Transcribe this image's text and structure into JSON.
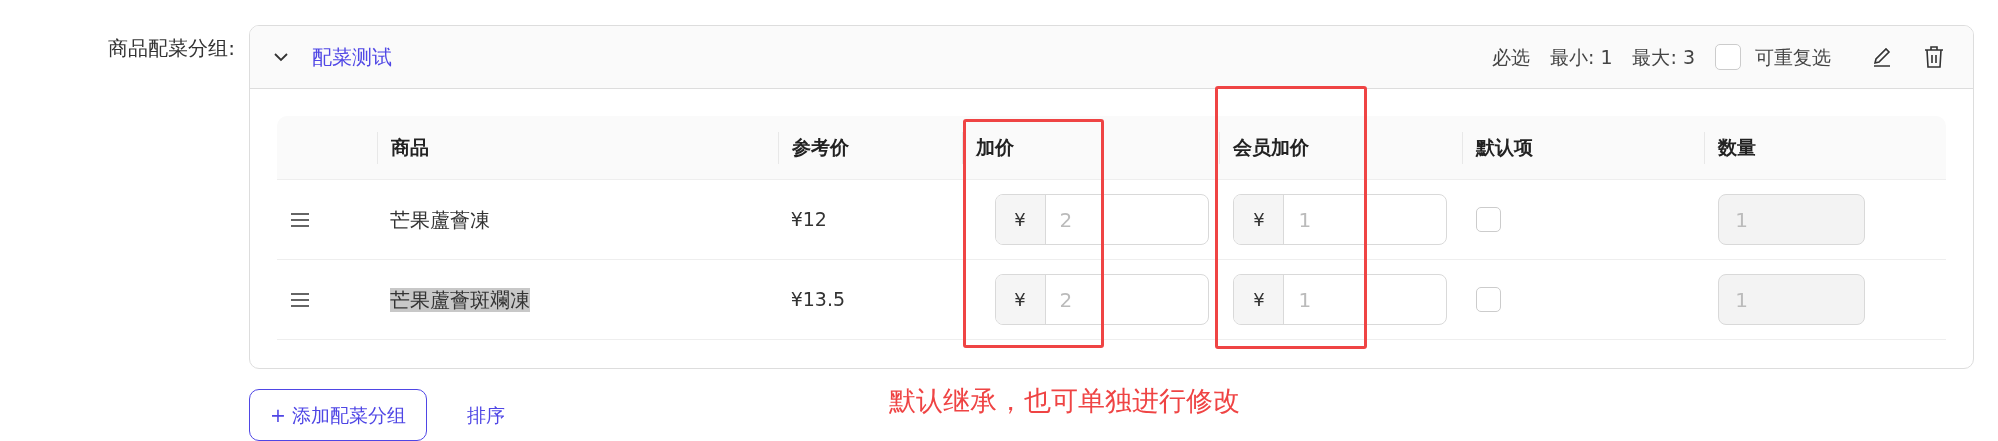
{
  "field_label": "商品配菜分组:",
  "group": {
    "expanded": true,
    "name": "配菜测试",
    "required": "必选",
    "min": "最小: 1",
    "max": "最大: 3",
    "repeatable": {
      "label": "可重复选",
      "checked": false
    }
  },
  "table": {
    "columns": [
      "商品",
      "参考价",
      "加价",
      "会员加价",
      "默认项",
      "数量"
    ],
    "rows": [
      {
        "name": "芒果蘆薈凍",
        "highlighted": false,
        "price": "¥12",
        "addon": {
          "prefix": "¥",
          "placeholder": "2"
        },
        "member_addon": {
          "prefix": "¥",
          "placeholder": "1"
        },
        "default": false,
        "quantity": {
          "placeholder": "1",
          "disabled": true
        }
      },
      {
        "name": "芒果蘆薈斑斕凍",
        "highlighted": true,
        "price": "¥13.5",
        "addon": {
          "prefix": "¥",
          "placeholder": "2"
        },
        "member_addon": {
          "prefix": "¥",
          "placeholder": "1"
        },
        "default": false,
        "quantity": {
          "placeholder": "1",
          "disabled": true
        }
      }
    ]
  },
  "buttons": {
    "add_group": "+ 添加配菜分组",
    "sort": "排序"
  },
  "annotation": "默认继承，也可单独进行修改"
}
